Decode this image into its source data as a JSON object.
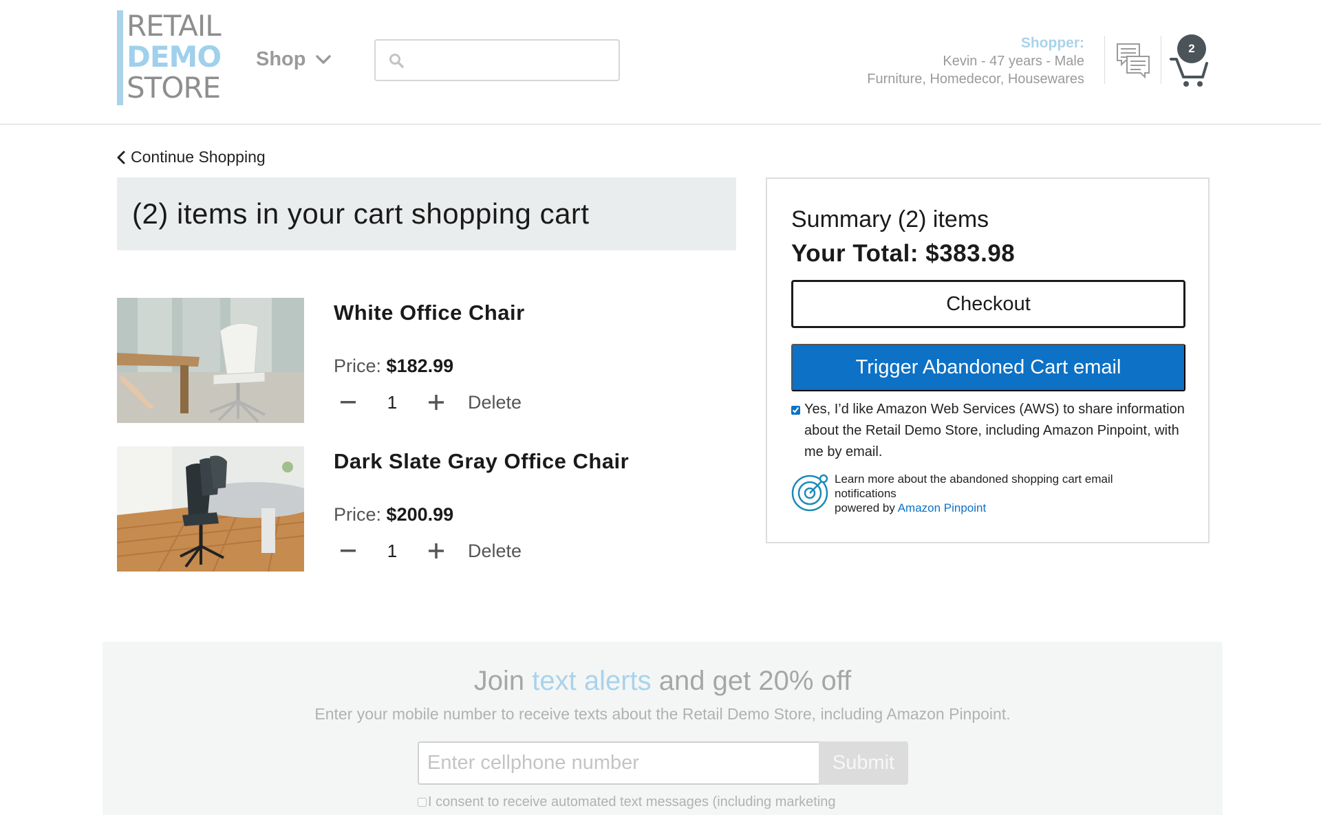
{
  "header": {
    "logo": {
      "line1": "RETAIL",
      "line2": "DEMO",
      "line3": "STORE"
    },
    "shop_menu": {
      "label": "Shop",
      "icon": "chevron-down-icon"
    },
    "search": {
      "placeholder": "",
      "icon": "search-icon"
    },
    "shopper": {
      "label": "Shopper:",
      "profile": "Kevin - 47 years - Male",
      "interests": "Furniture, Homedecor, Housewares"
    },
    "chat_icon": "chat-icon",
    "cart": {
      "count": "2",
      "icon": "shopping-cart-icon"
    }
  },
  "nav": {
    "continue_label": "Continue Shopping",
    "icon": "chevron-left-icon"
  },
  "cart": {
    "title": "(2) items in your cart shopping cart",
    "items": [
      {
        "name": "White Office Chair",
        "price_label": "Price:",
        "price": "$182.99",
        "quantity": "1",
        "delete_label": "Delete",
        "image": "white office chair photo"
      },
      {
        "name": "Dark Slate Gray Office Chair",
        "price_label": "Price:",
        "price": "$200.99",
        "quantity": "1",
        "delete_label": "Delete",
        "image": "dark slate gray office chair photo"
      }
    ]
  },
  "summary": {
    "count_label": "Summary (2) items",
    "total_label": "Your Total: $383.98",
    "checkout_label": "Checkout",
    "trigger_label": "Trigger Abandoned Cart email",
    "consent_text": "Yes, I’d like Amazon Web Services (AWS) to share information about the Retail Demo Store, including Amazon Pinpoint, with me by email.",
    "consent_checked": true,
    "learn_more": "Learn more about the abandoned shopping cart email notifications",
    "powered_by": "powered by",
    "pinpoint_link": "Amazon Pinpoint",
    "pinpoint_icon": "target-icon"
  },
  "footer": {
    "join_prefix": "Join",
    "join_accent": "text alerts",
    "join_suffix": "and get 20% off",
    "subtitle": "Enter your mobile number to receive texts about the Retail Demo Store, including Amazon Pinpoint.",
    "phone_placeholder": "Enter cellphone number",
    "submit_label": "Submit",
    "sms_consent": "I consent to receive automated text messages (including marketing"
  },
  "colors": {
    "accent_blue": "#0d71c5",
    "logo_blue": "#9fd0ec",
    "title_bg": "#eaeded",
    "footer_bg": "#f4f6f6",
    "badge": "#4b5459"
  }
}
